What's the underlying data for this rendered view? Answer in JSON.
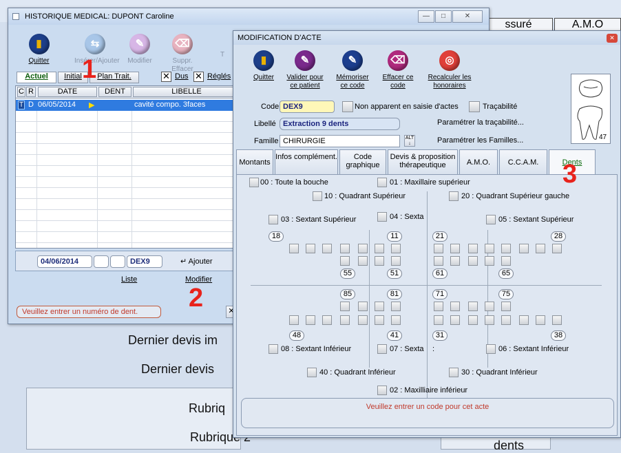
{
  "background": {
    "col1": "ssuré",
    "col2": "A.M.O",
    "line1": "Dernier devis im",
    "line2": "Dernier devis",
    "rub1": "Rubriq",
    "rub2": "Rubrique 2",
    "dents": "dents"
  },
  "hist": {
    "title": "HISTORIQUE MEDICAL: DUPONT Caroline",
    "tools": [
      "Quitter",
      "Insérer/Ajouter",
      "Modifier",
      "Suppr. Effacer"
    ],
    "tools_extra": "T",
    "tabs": [
      "Actuel",
      "Initial",
      "Plan Trait."
    ],
    "check_dus": "Dus",
    "check_regles": "Réglés",
    "headers": [
      "C",
      "R",
      "DATE",
      "DENT",
      "LIBELLE"
    ],
    "row": {
      "c": "T",
      "r": "D",
      "date": "06/05/2014",
      "libelle": "cavité compo. 3faces"
    },
    "date_field": "04/06/2014",
    "code_field": "DEX9",
    "ajouter": "Ajouter",
    "liste": "Liste",
    "modifier": "Modifier",
    "status": "Veuillez entrer un numéro de dent.",
    "min": "—",
    "max": "□",
    "close": "✕"
  },
  "annotations": {
    "a1": "1",
    "a2": "2",
    "a3": "3"
  },
  "acte": {
    "title": "MODIFICATION D'ACTE",
    "tools": [
      "Quitter",
      "Valider pour ce patient",
      "Mémoriser ce code",
      "Effacer ce code",
      "Recalculer les honoraires"
    ],
    "code_label": "Code",
    "code_value": "DEX9",
    "non_apparent": "Non apparent en saisie d'actes",
    "tracabilite": "Traçabilité",
    "libelle_label": "Libellé",
    "libelle_value": "Extraction 9 dents",
    "param_trac": "Paramétrer la traçabilité...",
    "famille_label": "Famille",
    "famille_value": "CHIRURGIE",
    "param_fam": "Paramétrer les Familles...",
    "alt": "ALT",
    "tooth_num": "47",
    "tabs": [
      "Montants",
      "Infos complément.",
      "Code graphique",
      "Devis & proposition thérapeutique",
      "A.M.O.",
      "C.C.A.M.",
      "Dents"
    ],
    "zones": {
      "z00": "00 : Toute la bouche",
      "z01": "01 : Maxillaire supérieur",
      "z10": "10 : Quadrant Supérieur",
      "z20": "20 : Quadrant Supérieur gauche",
      "z03": "03 : Sextant Supérieur",
      "z04": "04 : Sexta",
      "z05": "05 : Sextant Supérieur",
      "z08": "08 : Sextant Inférieur",
      "z07": "07 : Sexta",
      "z07b": ":",
      "z06": "06 : Sextant Inférieur",
      "z40": "40 : Quadrant Inférieur",
      "z30": "30 : Quadrant Inférieur",
      "z02": "02 : Maxilliaire inférieur"
    },
    "teeth": {
      "t18": "18",
      "t11": "11",
      "t21": "21",
      "t28": "28",
      "t55": "55",
      "t51": "51",
      "t61": "61",
      "t65": "65",
      "t85": "85",
      "t81": "81",
      "t71": "71",
      "t75": "75",
      "t48": "48",
      "t41": "41",
      "t31": "31",
      "t38": "38"
    },
    "status": "Veuillez entrer un code pour cet acte"
  }
}
